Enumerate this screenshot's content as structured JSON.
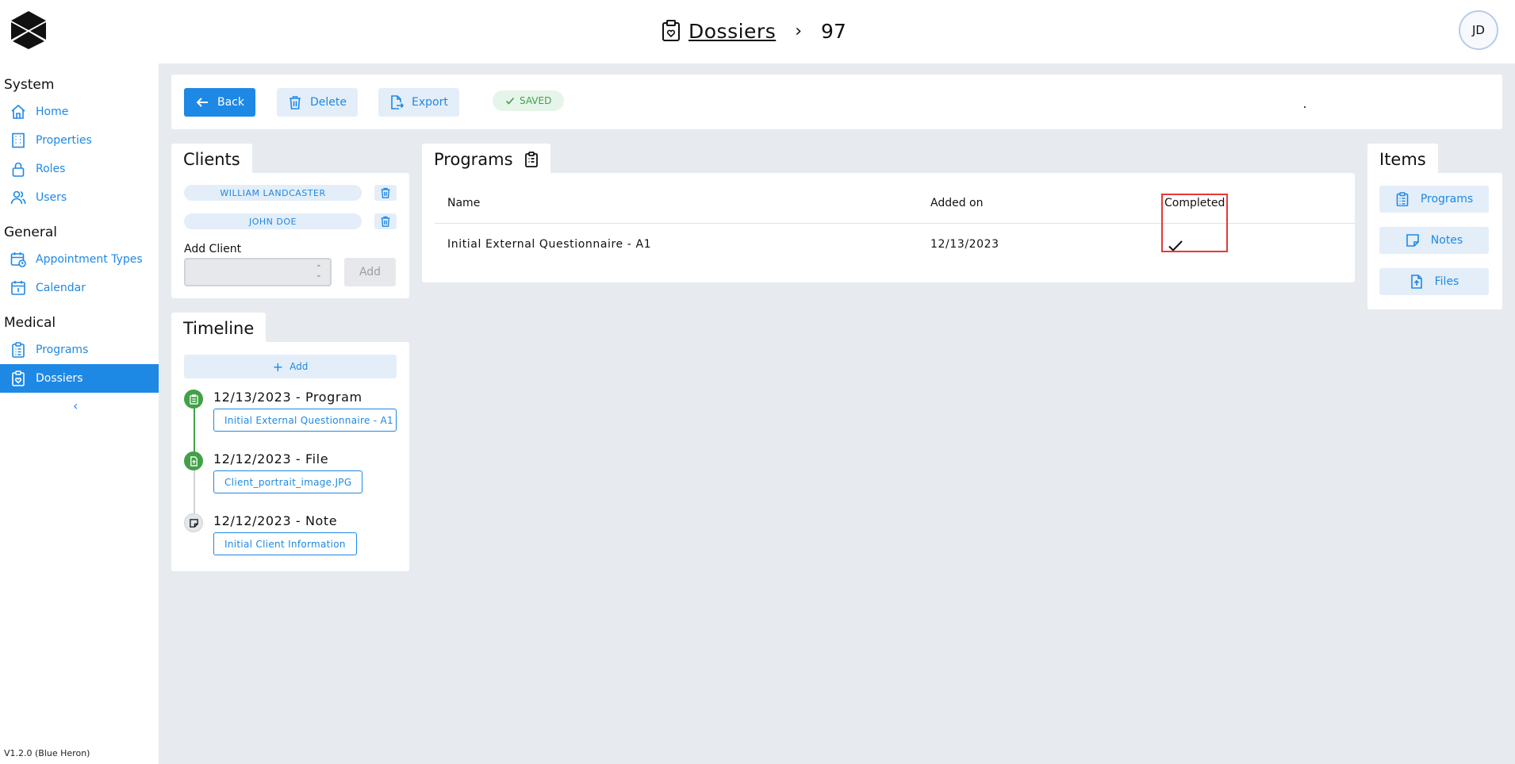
{
  "header": {
    "breadcrumb_link": "Dossiers",
    "breadcrumb_separator": "›",
    "record_id": "97",
    "avatar_initials": "JD"
  },
  "sidebar": {
    "sections": [
      {
        "title": "System",
        "items": [
          {
            "label": "Home",
            "icon": "home-icon"
          },
          {
            "label": "Properties",
            "icon": "building-icon"
          },
          {
            "label": "Roles",
            "icon": "lock-icon"
          },
          {
            "label": "Users",
            "icon": "users-icon"
          }
        ]
      },
      {
        "title": "General",
        "items": [
          {
            "label": "Appointment Types",
            "icon": "calendar-clock-icon"
          },
          {
            "label": "Calendar",
            "icon": "calendar-icon"
          }
        ]
      },
      {
        "title": "Medical",
        "items": [
          {
            "label": "Programs",
            "icon": "clipboard-icon"
          },
          {
            "label": "Dossiers",
            "icon": "clipboard-heart-icon",
            "active": true
          }
        ]
      }
    ],
    "collapse_symbol": "‹",
    "version": "V1.2.0 (Blue Heron)"
  },
  "toolbar": {
    "back_label": "Back",
    "delete_label": "Delete",
    "export_label": "Export",
    "status_label": "SAVED"
  },
  "clients": {
    "title": "Clients",
    "list": [
      "WILLIAM LANDCASTER",
      "JOHN DOE"
    ],
    "add_label": "Add Client",
    "add_button": "Add"
  },
  "timeline": {
    "title": "Timeline",
    "add_label": "Add",
    "entries": [
      {
        "title": "12/13/2023 - Program",
        "chip": "Initial External Questionnaire - A1",
        "type": "program"
      },
      {
        "title": "12/12/2023 - File",
        "chip": "Client_portrait_image.JPG",
        "type": "file"
      },
      {
        "title": "12/12/2023 - Note",
        "chip": "Initial Client Information",
        "type": "note"
      }
    ]
  },
  "programs": {
    "title": "Programs",
    "columns": [
      "Name",
      "Added on",
      "Completed"
    ],
    "rows": [
      {
        "name": "Initial External Questionnaire - A1",
        "added_on": "12/13/2023",
        "completed": true
      }
    ]
  },
  "items": {
    "title": "Items",
    "buttons": [
      "Programs",
      "Notes",
      "Files"
    ]
  },
  "colors": {
    "primary": "#1e88e5",
    "light_primary": "#e3eef9",
    "success": "#43a047",
    "highlight": "#e53935",
    "background": "#e7eaee"
  }
}
